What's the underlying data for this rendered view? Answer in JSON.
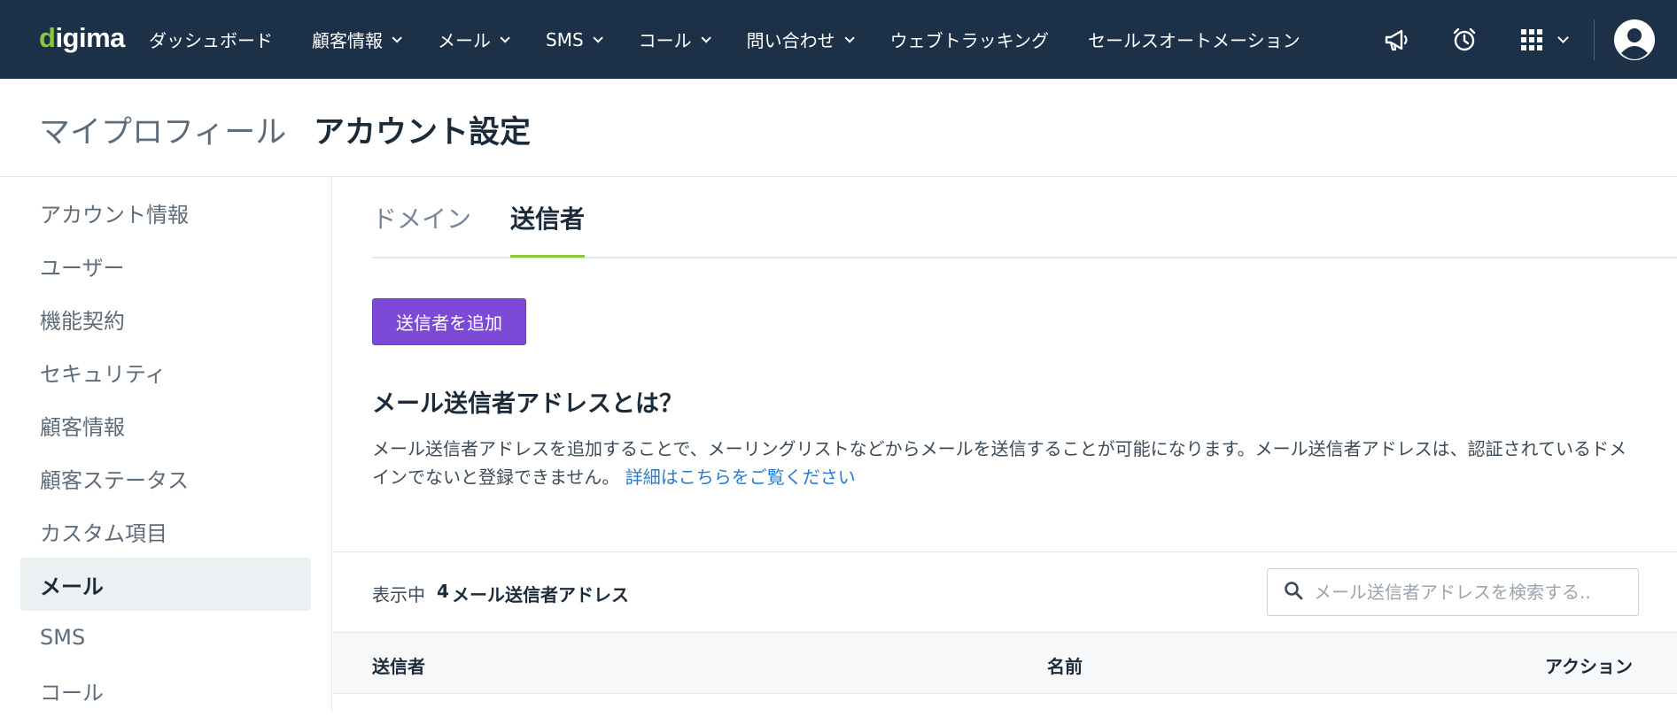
{
  "app": {
    "logo_text": "digima",
    "brand_color": "#8cc63f",
    "nav_bg": "#1c3048",
    "accent": "#7d4ad8"
  },
  "nav": {
    "items": [
      {
        "label": "ダッシュボード",
        "dropdown": false
      },
      {
        "label": "顧客情報",
        "dropdown": true
      },
      {
        "label": "メール",
        "dropdown": true
      },
      {
        "label": "SMS",
        "dropdown": true
      },
      {
        "label": "コール",
        "dropdown": true
      },
      {
        "label": "問い合わせ",
        "dropdown": true
      },
      {
        "label": "ウェブトラッキング",
        "dropdown": false
      },
      {
        "label": "セールスオートメーション",
        "dropdown": false
      }
    ],
    "icons": [
      "megaphone-icon",
      "alarm-clock-icon",
      "apps-grid-icon",
      "user-avatar-icon"
    ]
  },
  "header": {
    "profile_tab": "マイプロフィール",
    "account_tab": "アカウント設定"
  },
  "sidebar": {
    "items": [
      {
        "label": "アカウント情報"
      },
      {
        "label": "ユーザー"
      },
      {
        "label": "機能契約"
      },
      {
        "label": "セキュリティ"
      },
      {
        "label": "顧客情報"
      },
      {
        "label": "顧客ステータス"
      },
      {
        "label": "カスタム項目"
      },
      {
        "label": "メール",
        "active": true
      },
      {
        "label": "SMS"
      },
      {
        "label": "コール"
      }
    ]
  },
  "main": {
    "tabs": [
      {
        "label": "ドメイン"
      },
      {
        "label": "送信者",
        "active": true
      }
    ],
    "add_button": "送信者を追加",
    "help": {
      "title": "メール送信者アドレスとは？",
      "text": "メール送信者アドレスを追加することで、メーリングリストなどからメールを送信することが可能になります。メール送信者アドレスは、認証されているドメインでないと登録できません。",
      "link": "詳細はこちらをご覧ください"
    },
    "list": {
      "showing_label": "表示中",
      "count": "4",
      "unit": "メール送信者アドレス",
      "search_placeholder": "メール送信者アドレスを検索する.."
    },
    "table": {
      "columns": [
        "送信者",
        "名前",
        "アクション"
      ]
    }
  }
}
